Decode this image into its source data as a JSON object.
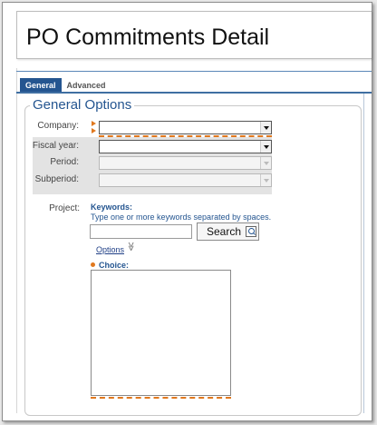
{
  "page": {
    "title": "PO Commitments Detail"
  },
  "tabs": [
    {
      "label": "General",
      "active": true
    },
    {
      "label": "Advanced",
      "active": false
    }
  ],
  "section": {
    "title": "General Options"
  },
  "fields": {
    "company": {
      "label": "Company:",
      "value": "",
      "required": true
    },
    "fiscal_year": {
      "label": "Fiscal year:",
      "value": ""
    },
    "period": {
      "label": "Period:",
      "value": "",
      "disabled": true
    },
    "subperiod": {
      "label": "Subperiod:",
      "value": "",
      "disabled": true
    }
  },
  "project": {
    "label": "Project:",
    "keywords_label": "Keywords:",
    "keywords_hint": "Type one or more keywords separated by spaces.",
    "keywords_value": "",
    "search_label": "Search",
    "options_link": "Options",
    "options_chevron": "≫",
    "choice_label": "Choice:",
    "choice_items": []
  },
  "colors": {
    "accent": "#245590",
    "required": "#e0781e",
    "panel": "#e3e3e3"
  },
  "icons": {
    "search": "magnifier-icon",
    "dropdown": "chevron-down-icon",
    "options": "double-chevron-down-icon"
  }
}
